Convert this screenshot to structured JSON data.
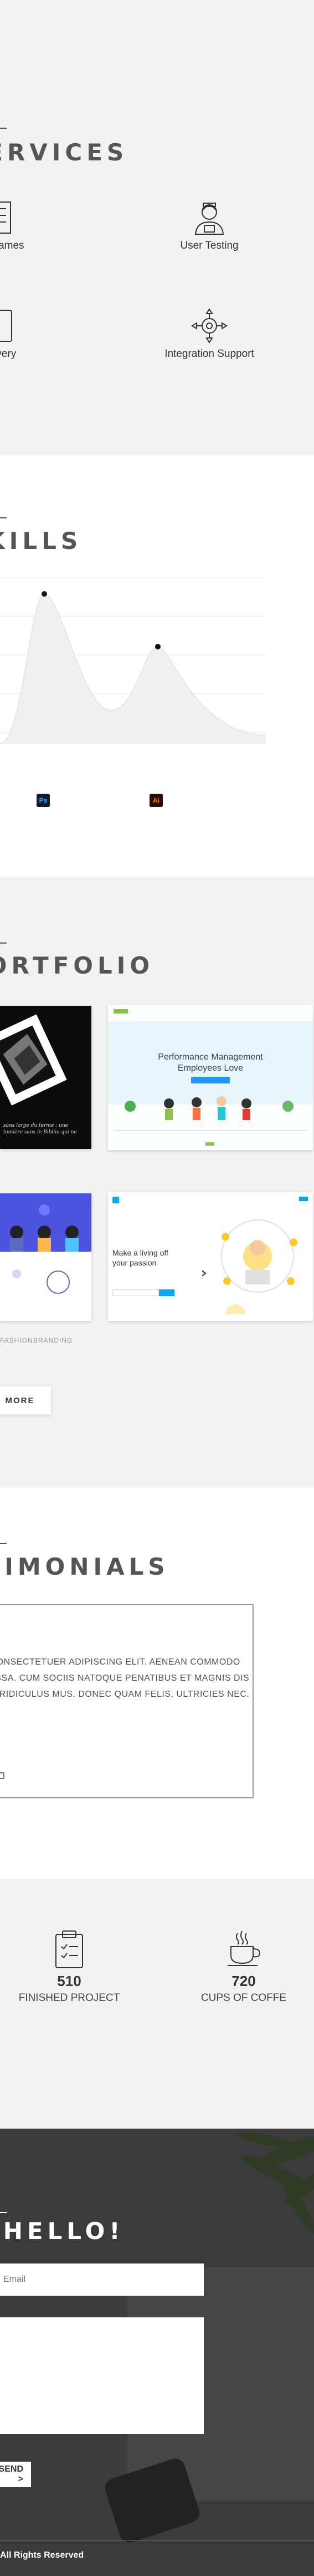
{
  "services": {
    "title": "SERVICES",
    "items": [
      {
        "label": "Wireframes",
        "icon": "wireframes-icon"
      },
      {
        "label": "User Testing",
        "icon": "user-testing-icon"
      },
      {
        "label": "Delivery",
        "icon": "delivery-icon"
      },
      {
        "label": "Integration Support",
        "icon": "integration-support-icon"
      }
    ]
  },
  "skills": {
    "title": "SKILLS",
    "badges": [
      {
        "label": "Ps",
        "bg": "#0b1d33",
        "fg": "#31a8ff"
      },
      {
        "label": "Ai",
        "bg": "#2b0d00",
        "fg": "#ff7c00"
      }
    ]
  },
  "portfolio": {
    "title": "PORTFOLIO",
    "card_dark_text": "sans large du terme : une lumière sans le Bibliio qui ne",
    "card_perf_title": "Performance Management Employees Love",
    "card_living_title": "Make a living off your passion",
    "tags": [
      "FASHION",
      "BRANDING"
    ],
    "more_label": "MORE"
  },
  "testimonials": {
    "title": "TESTIMONIALS",
    "quote": "LOREM IPSUM DOLOR SIT AMET, CONSECTETUER ADIPISCING ELIT. AENEAN COMMODO LIGULA EGET DOLOR. AENEAN MASSA. CUM SOCIIS NATOQUE PENATIBUS ET MAGNIS DIS PARTURIENT MONTES, NASCETUR RIDICULUS MUS. DONEC QUAM FELIS, ULTRICIES NEC."
  },
  "stats": [
    {
      "number": "510",
      "caption": "FINISHED PROJECT",
      "icon": "clipboard-icon"
    },
    {
      "number": "720",
      "caption": "CUPS OF COFFE",
      "icon": "coffee-cup-icon"
    }
  ],
  "contact": {
    "title": "SAY HELLO!",
    "email_placeholder": "Email",
    "send_label": "SEND >",
    "footer": "All Rights Reserved"
  }
}
